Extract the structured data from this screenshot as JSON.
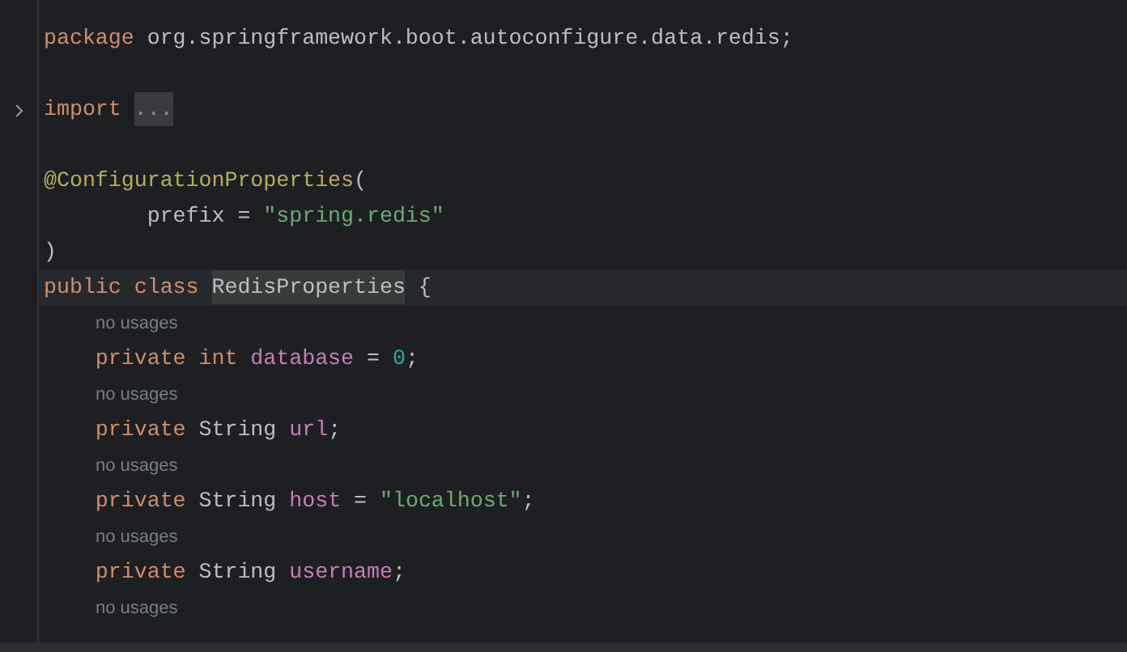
{
  "editor": {
    "lines": [
      {
        "kind": "code",
        "current": false,
        "collapsed": false,
        "tokens": [
          {
            "text": "package ",
            "kind": "keyword"
          },
          {
            "text": "org.springframework.boot.autoconfigure.data.redis;",
            "kind": "plain"
          }
        ]
      },
      {
        "kind": "blank",
        "current": false,
        "collapsed": false
      },
      {
        "kind": "code",
        "current": false,
        "collapsed": true,
        "tokens": [
          {
            "text": "import ",
            "kind": "keyword"
          },
          {
            "text": "...",
            "kind": "folded"
          }
        ]
      },
      {
        "kind": "blank",
        "current": false,
        "collapsed": false
      },
      {
        "kind": "code",
        "current": false,
        "collapsed": false,
        "tokens": [
          {
            "text": "@ConfigurationProperties",
            "kind": "annotation"
          },
          {
            "text": "(",
            "kind": "plain"
          }
        ]
      },
      {
        "kind": "code",
        "current": false,
        "collapsed": false,
        "tokens": [
          {
            "text": "        prefix = ",
            "kind": "plain"
          },
          {
            "text": "\"spring.redis\"",
            "kind": "string"
          }
        ]
      },
      {
        "kind": "code",
        "current": false,
        "collapsed": false,
        "tokens": [
          {
            "text": ")",
            "kind": "plain"
          }
        ]
      },
      {
        "kind": "code",
        "current": true,
        "collapsed": false,
        "tokens": [
          {
            "text": "public class ",
            "kind": "keyword"
          },
          {
            "text": "RedisProperties",
            "kind": "usage"
          },
          {
            "text": " {",
            "kind": "plain"
          }
        ]
      },
      {
        "kind": "hint",
        "current": false,
        "collapsed": false,
        "text": "no usages"
      },
      {
        "kind": "code",
        "current": false,
        "collapsed": false,
        "tokens": [
          {
            "text": "    private int ",
            "kind": "keyword"
          },
          {
            "text": "database",
            "kind": "field"
          },
          {
            "text": " = ",
            "kind": "plain"
          },
          {
            "text": "0",
            "kind": "number"
          },
          {
            "text": ";",
            "kind": "plain"
          }
        ]
      },
      {
        "kind": "hint",
        "current": false,
        "collapsed": false,
        "text": "no usages"
      },
      {
        "kind": "code",
        "current": false,
        "collapsed": false,
        "tokens": [
          {
            "text": "    private ",
            "kind": "keyword"
          },
          {
            "text": "String ",
            "kind": "plain"
          },
          {
            "text": "url",
            "kind": "field"
          },
          {
            "text": ";",
            "kind": "plain"
          }
        ]
      },
      {
        "kind": "hint",
        "current": false,
        "collapsed": false,
        "text": "no usages"
      },
      {
        "kind": "code",
        "current": false,
        "collapsed": false,
        "tokens": [
          {
            "text": "    private ",
            "kind": "keyword"
          },
          {
            "text": "String ",
            "kind": "plain"
          },
          {
            "text": "host",
            "kind": "field"
          },
          {
            "text": " = ",
            "kind": "plain"
          },
          {
            "text": "\"localhost\"",
            "kind": "string"
          },
          {
            "text": ";",
            "kind": "plain"
          }
        ]
      },
      {
        "kind": "hint",
        "current": false,
        "collapsed": false,
        "text": "no usages"
      },
      {
        "kind": "code",
        "current": false,
        "collapsed": false,
        "tokens": [
          {
            "text": "    private ",
            "kind": "keyword"
          },
          {
            "text": "String ",
            "kind": "plain"
          },
          {
            "text": "username",
            "kind": "field"
          },
          {
            "text": ";",
            "kind": "plain"
          }
        ]
      },
      {
        "kind": "hint",
        "current": false,
        "collapsed": false,
        "text": "no usages"
      }
    ]
  }
}
